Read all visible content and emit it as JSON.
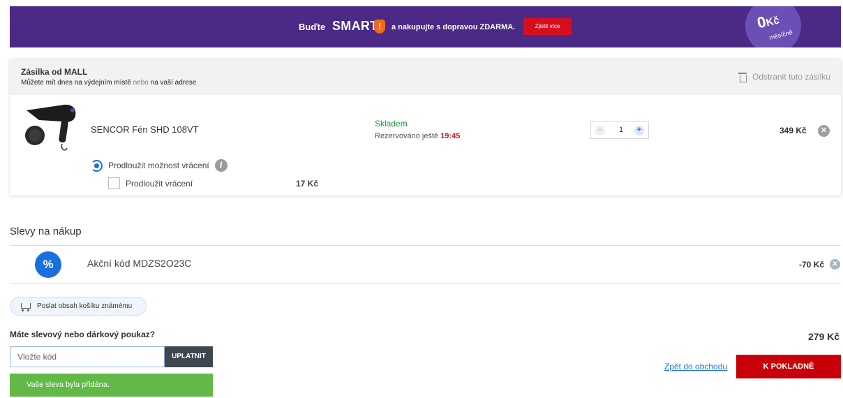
{
  "banner": {
    "pre": "Buďte",
    "brand": "SMART",
    "brand_mark": "!",
    "post": "a nakupujte s dopravou ZDARMA.",
    "cta": "Zjistit více",
    "price_num": "0",
    "price_currency": "Kč",
    "price_period": "měsíčně",
    "colors": {
      "background": "#4a2a86",
      "cta": "#d60f1e"
    }
  },
  "shipment": {
    "title": "Zásilka od MALL",
    "subtitle_a": "Můžete mít dnes na výdejním místě",
    "subtitle_or": "nebo",
    "subtitle_b": "na vaší adrese",
    "remove_label": "Odstranit tuto zásilku",
    "remove_icon": "trash-icon",
    "item": {
      "name": "SENCOR Fén SHD 108VT",
      "stock": "Skladem",
      "reserved_label": "Rezervováno ještě",
      "reserved_time": "19:45",
      "quantity": "1",
      "price": "349 Kč",
      "remove_icon": "close-icon"
    },
    "extension": {
      "heading": "Prodloužit možnost vrácení",
      "info": "i",
      "checkbox_label": "Prodloužit vrácení",
      "price": "17 Kč"
    }
  },
  "discounts": {
    "title": "Slevy na nákup",
    "percent_symbol": "%",
    "code_label": "Akční kód MDZS2O23C",
    "value": "-70 Kč"
  },
  "send_cart": {
    "label": "Poslat obsah košíku známému",
    "icon": "cart-icon"
  },
  "voucher": {
    "question": "Máte slevový nebo dárkový poukaz?",
    "placeholder": "Vložte kód",
    "apply": "UPLATNIT",
    "success": "Vaše sleva byla přidána."
  },
  "summary": {
    "total": "279 Kč",
    "back": "Zpět do obchodu",
    "checkout": "K POKLADNĚ"
  }
}
